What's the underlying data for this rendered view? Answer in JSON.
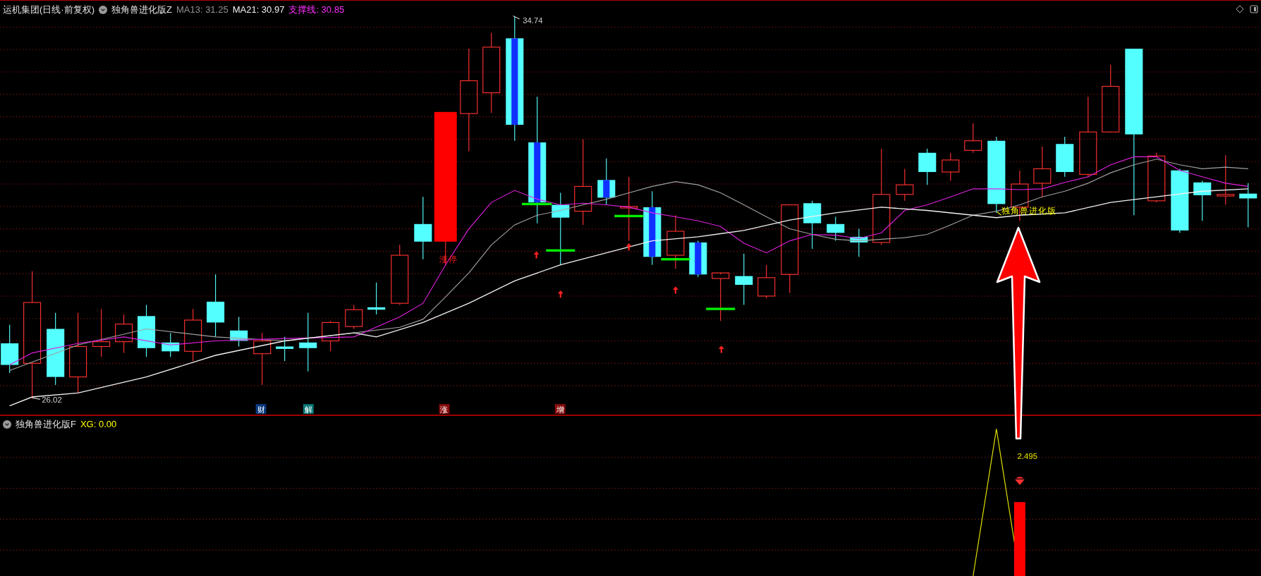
{
  "header": {
    "stock": "运机集团(日线·前复权)",
    "indicator": "独角兽进化版Z",
    "ma13": "MA13: 31.25",
    "ma21": "MA21: 30.97",
    "support": "支撑线: 30.85"
  },
  "main_chart": {
    "high_label": "34.74",
    "low_label": "26.02",
    "limit_up_label": "涨停",
    "signal_label": "独角兽进化版",
    "markers": [
      {
        "text": "财",
        "color": "#0b3b80"
      },
      {
        "text": "解",
        "color": "#0b7a78"
      },
      {
        "text": "涨",
        "color": "#8a0c0c"
      },
      {
        "text": "增",
        "color": "#8a0c0c"
      }
    ]
  },
  "sub_pane": {
    "indicator": "独角兽进化版F",
    "xg": "XG: 0.00",
    "peak_label": "2.495"
  }
}
